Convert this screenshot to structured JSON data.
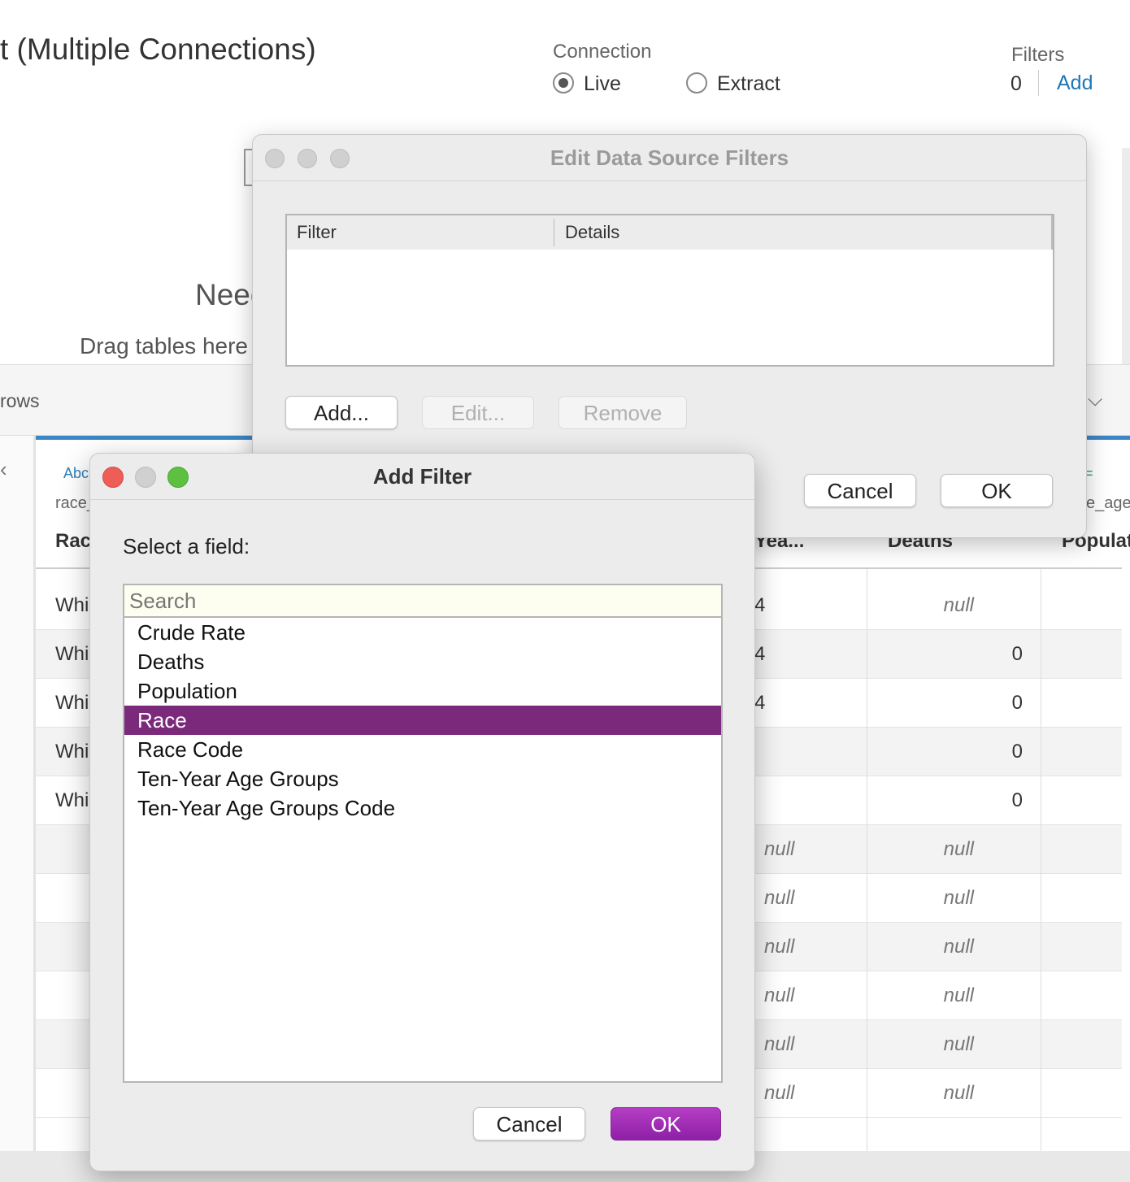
{
  "background": {
    "title": "t (Multiple Connections)",
    "connection": {
      "label": "Connection",
      "live": "Live",
      "extract": "Extract",
      "selected": "Live"
    },
    "filters": {
      "label": "Filters",
      "count": "0",
      "add": "Add"
    },
    "canvas": {
      "need_text": "Need",
      "drag_text": "Drag tables here"
    },
    "rows_label": "rows",
    "grid": {
      "columns": [
        {
          "type_icon": "Abc",
          "source": "race_",
          "name": "Rac"
        },
        {
          "name": "Yea..."
        },
        {
          "name": "Deaths"
        },
        {
          "type_icon": "=",
          "source": "e_age_",
          "name": "Populat"
        }
      ],
      "rows": [
        {
          "race": "Whi",
          "year": "4",
          "deaths": "null"
        },
        {
          "race": "Whi",
          "year": "4",
          "deaths": "0"
        },
        {
          "race": "Whi",
          "year": "4",
          "deaths": "0"
        },
        {
          "race": "Whi",
          "year": "",
          "deaths": "0"
        },
        {
          "race": "Whi",
          "year": "",
          "deaths": "0"
        },
        {
          "race": "",
          "year": "null",
          "deaths": "null"
        },
        {
          "race": "",
          "year": "null",
          "deaths": "null"
        },
        {
          "race": "",
          "year": "null",
          "deaths": "null"
        },
        {
          "race": "",
          "year": "null",
          "deaths": "null"
        },
        {
          "race": "",
          "year": "null",
          "deaths": "null"
        },
        {
          "race": "",
          "year": "null",
          "deaths": "null"
        }
      ]
    }
  },
  "edit_dialog": {
    "title": "Edit Data Source Filters",
    "columns": {
      "filter": "Filter",
      "details": "Details"
    },
    "buttons": {
      "add": "Add...",
      "edit": "Edit...",
      "remove": "Remove",
      "cancel": "Cancel",
      "ok": "OK"
    }
  },
  "add_filter_dialog": {
    "title": "Add Filter",
    "prompt": "Select a field:",
    "search_placeholder": "Search",
    "fields": [
      "Crude Rate",
      "Deaths",
      "Population",
      "Race",
      "Race Code",
      "Ten-Year Age Groups",
      "Ten-Year Age Groups Code"
    ],
    "selected_field": "Race",
    "buttons": {
      "cancel": "Cancel",
      "ok": "OK"
    }
  },
  "colors": {
    "selection": "#7b297b",
    "ok_button": "#9b2bb3",
    "link": "#1f77b4",
    "close": "#ee5e57",
    "zoom": "#5dc040"
  }
}
